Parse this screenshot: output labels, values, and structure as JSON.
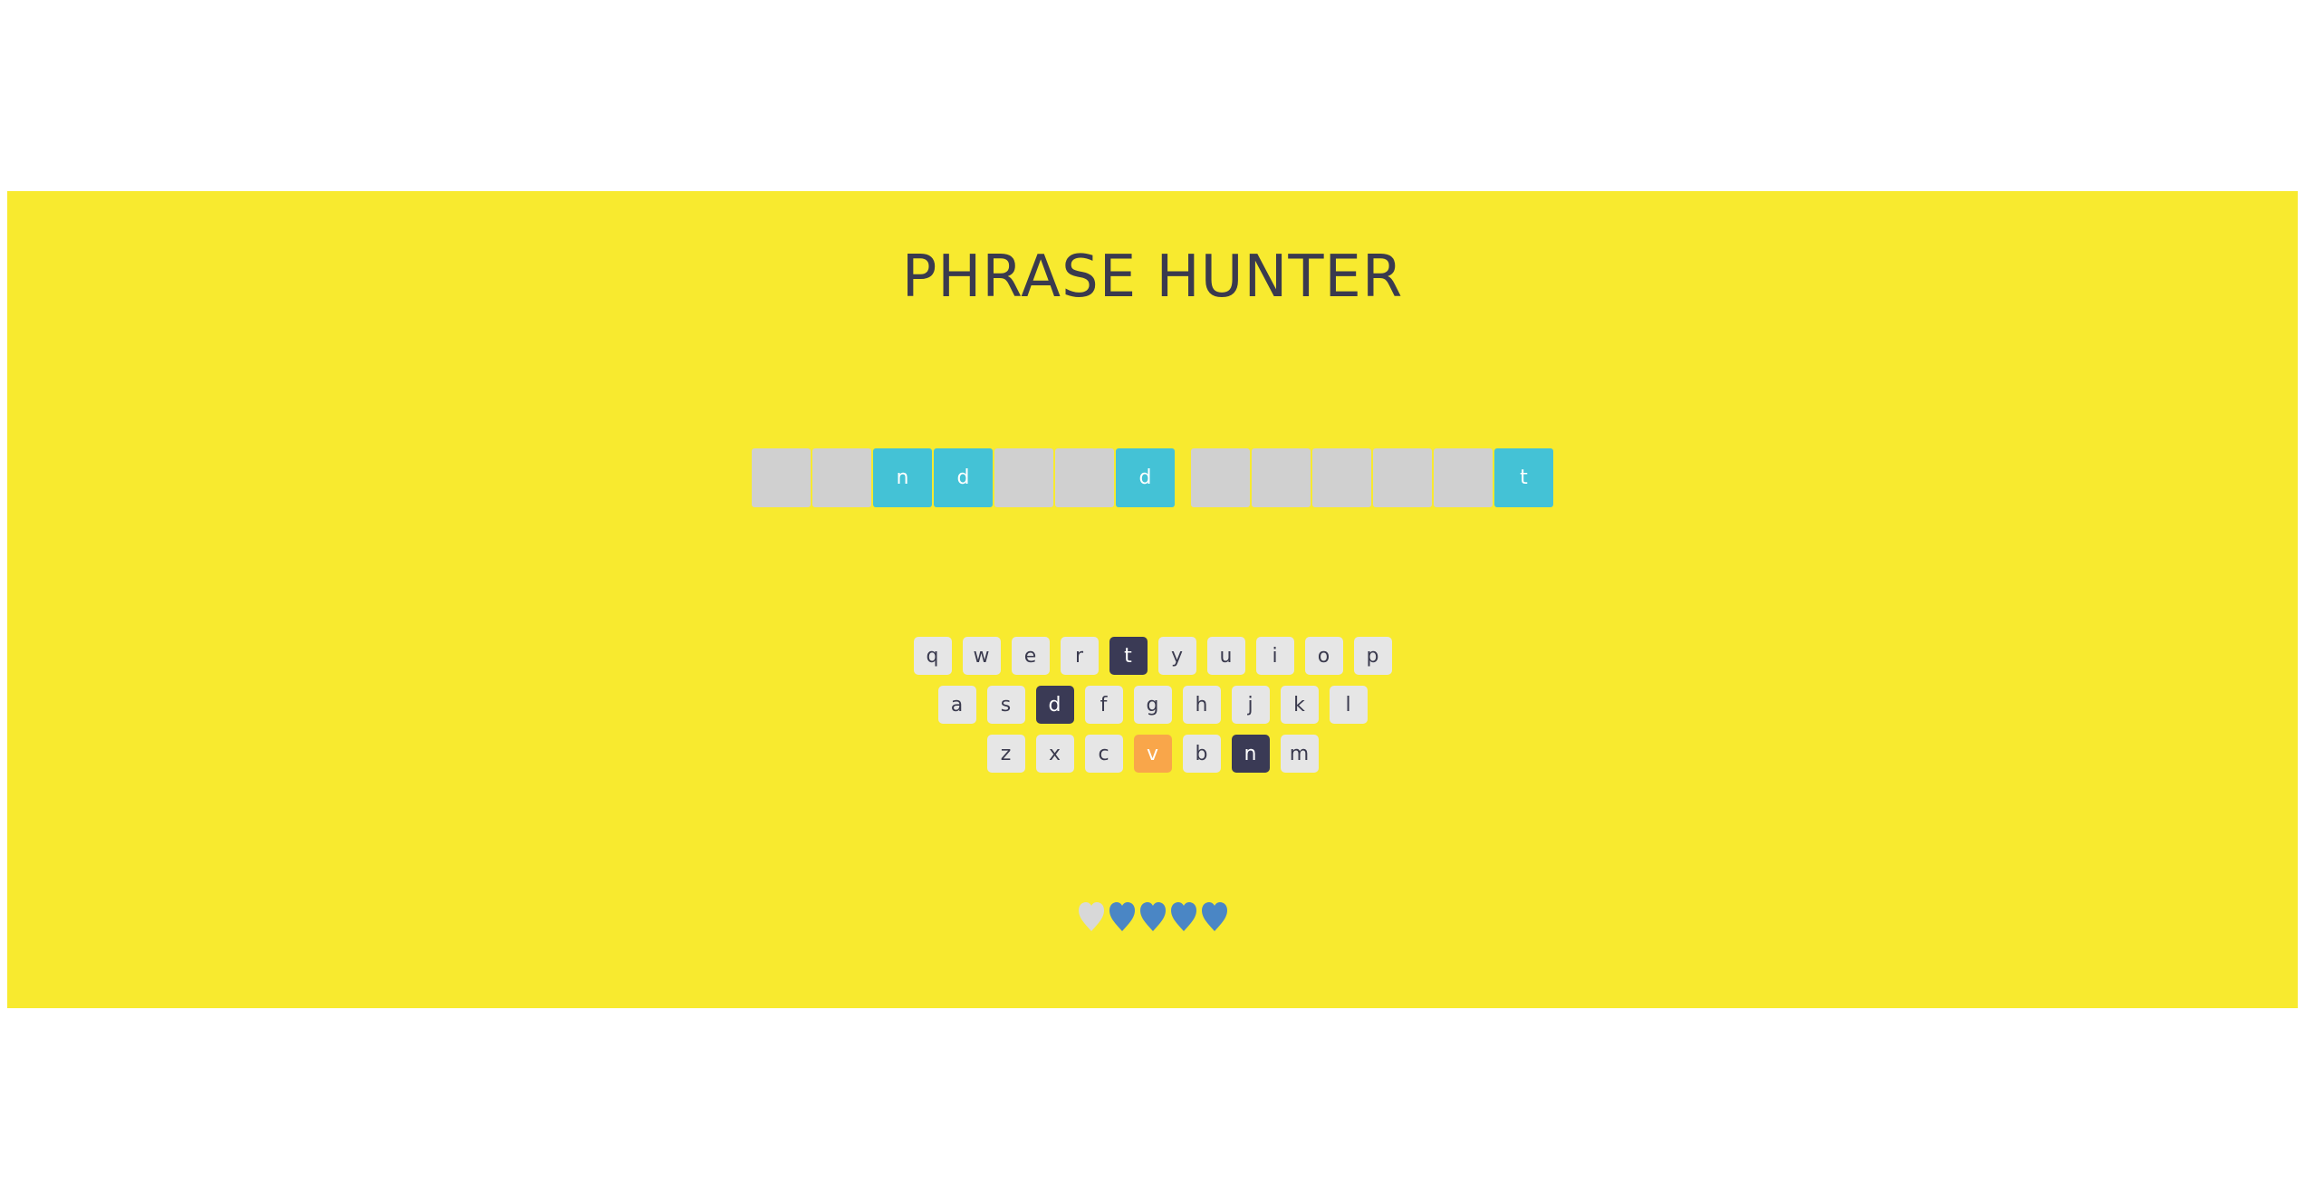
{
  "game": {
    "title": "PHRASE HUNTER"
  },
  "phrase": {
    "words": [
      [
        {
          "letter": "",
          "revealed": false
        },
        {
          "letter": "",
          "revealed": false
        },
        {
          "letter": "n",
          "revealed": true
        },
        {
          "letter": "d",
          "revealed": true
        },
        {
          "letter": "",
          "revealed": false
        },
        {
          "letter": "",
          "revealed": false
        },
        {
          "letter": "d",
          "revealed": true
        }
      ],
      [
        {
          "letter": "",
          "revealed": false
        },
        {
          "letter": "",
          "revealed": false
        },
        {
          "letter": "",
          "revealed": false
        },
        {
          "letter": "",
          "revealed": false
        },
        {
          "letter": "",
          "revealed": false
        },
        {
          "letter": "t",
          "revealed": true
        }
      ]
    ]
  },
  "keyboard": {
    "rows": [
      [
        {
          "key": "q",
          "state": "default"
        },
        {
          "key": "w",
          "state": "default"
        },
        {
          "key": "e",
          "state": "default"
        },
        {
          "key": "r",
          "state": "default"
        },
        {
          "key": "t",
          "state": "chosen"
        },
        {
          "key": "y",
          "state": "default"
        },
        {
          "key": "u",
          "state": "default"
        },
        {
          "key": "i",
          "state": "default"
        },
        {
          "key": "o",
          "state": "default"
        },
        {
          "key": "p",
          "state": "default"
        }
      ],
      [
        {
          "key": "a",
          "state": "default"
        },
        {
          "key": "s",
          "state": "default"
        },
        {
          "key": "d",
          "state": "chosen"
        },
        {
          "key": "f",
          "state": "default"
        },
        {
          "key": "g",
          "state": "default"
        },
        {
          "key": "h",
          "state": "default"
        },
        {
          "key": "j",
          "state": "default"
        },
        {
          "key": "k",
          "state": "default"
        },
        {
          "key": "l",
          "state": "default"
        }
      ],
      [
        {
          "key": "z",
          "state": "default"
        },
        {
          "key": "x",
          "state": "default"
        },
        {
          "key": "c",
          "state": "default"
        },
        {
          "key": "v",
          "state": "wrong"
        },
        {
          "key": "b",
          "state": "default"
        },
        {
          "key": "n",
          "state": "chosen"
        },
        {
          "key": "m",
          "state": "default"
        }
      ]
    ]
  },
  "lives": {
    "total": 5,
    "remaining": 4,
    "icon": "heart-icon",
    "color_live": "#4a86c5",
    "color_lost": "#d8d8d8"
  },
  "colors": {
    "banner": "#f8ea2f",
    "title": "#3a3a4e",
    "tile_hidden": "#d0d0d0",
    "tile_revealed": "#44c2d6",
    "key_default": "#e6e6e6",
    "key_chosen": "#3a3a55",
    "key_wrong": "#f9a64a"
  }
}
